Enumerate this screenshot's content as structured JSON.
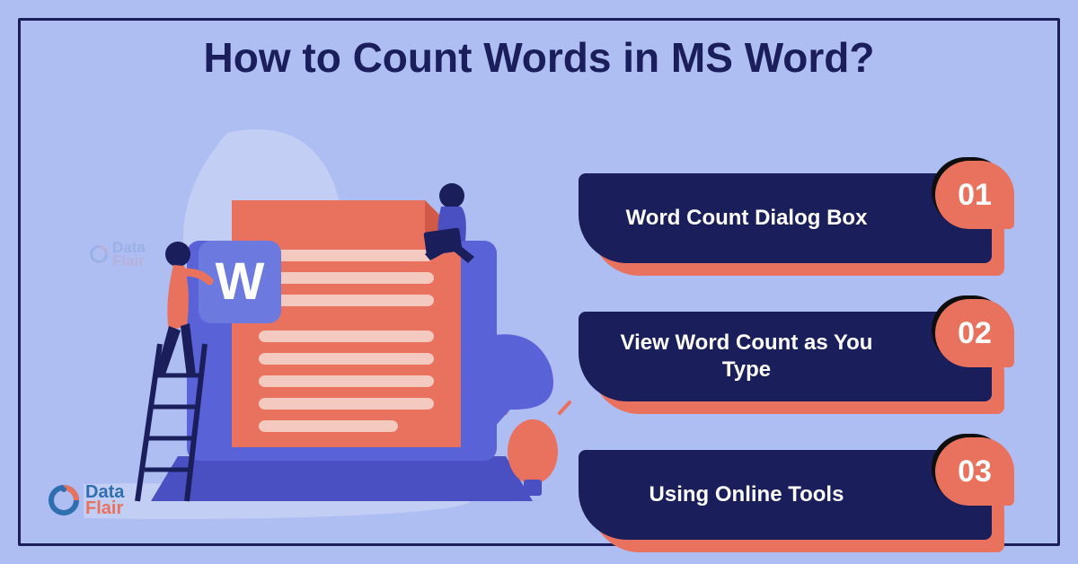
{
  "title": "How to Count Words in MS Word?",
  "brand": {
    "line1": "Data",
    "line2": "Flair"
  },
  "items": [
    {
      "number": "01",
      "label": "Word Count Dialog Box"
    },
    {
      "number": "02",
      "label": "View Word Count as You Type"
    },
    {
      "number": "03",
      "label": "Using Online Tools"
    }
  ],
  "illustration": {
    "word_icon_letter": "W"
  }
}
